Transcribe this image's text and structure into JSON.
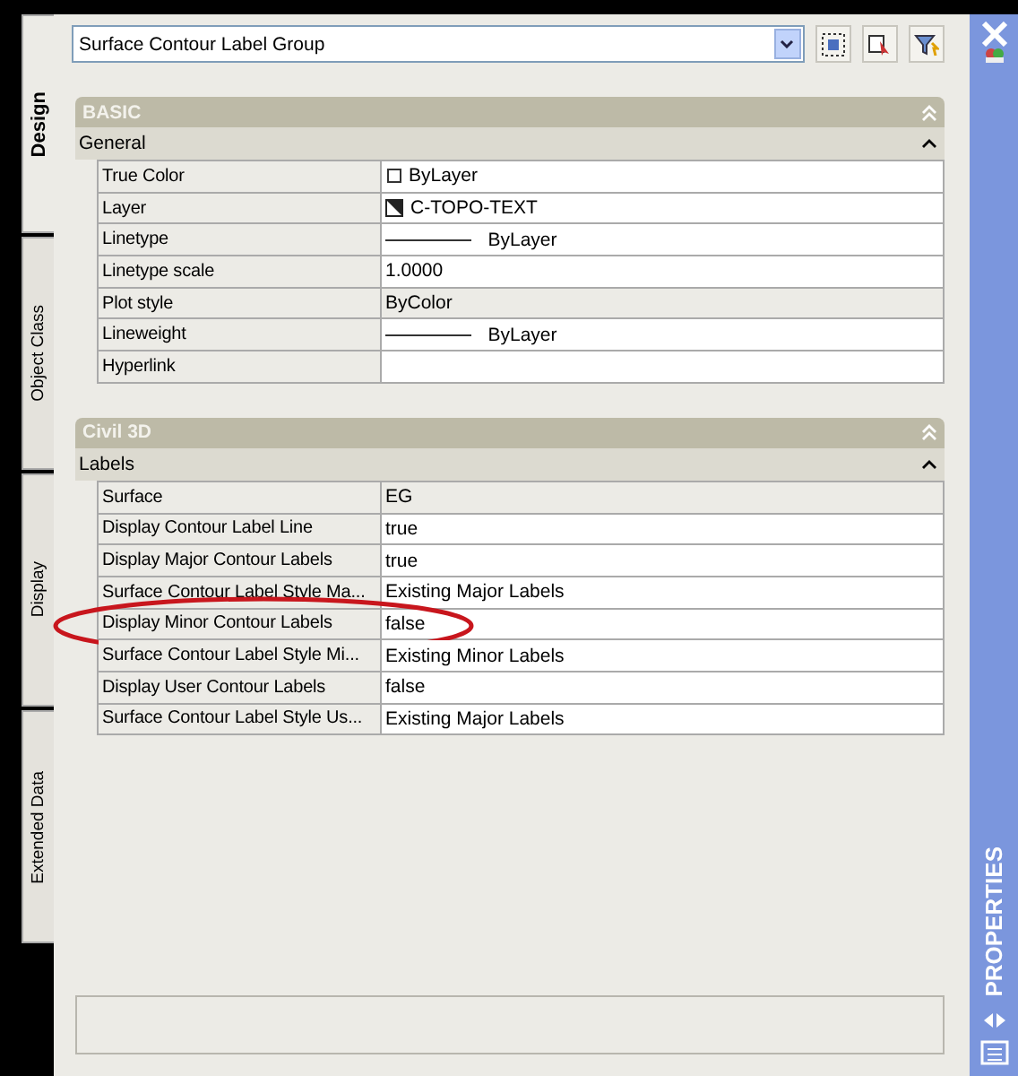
{
  "tabs": [
    {
      "label": "Design",
      "selected": true
    },
    {
      "label": "Object Class",
      "selected": false
    },
    {
      "label": "Display",
      "selected": false
    },
    {
      "label": "Extended Data",
      "selected": false
    }
  ],
  "selector": {
    "value": "Surface Contour Label Group"
  },
  "sections": [
    {
      "title": "BASIC",
      "groups": [
        {
          "title": "General",
          "expanded": true,
          "rows": [
            {
              "name": "True Color",
              "value": "ByLayer",
              "kind": "swatch",
              "readonly": false,
              "circled": false
            },
            {
              "name": "Layer",
              "value": "C-TOPO-TEXT",
              "kind": "layer",
              "readonly": false,
              "circled": false
            },
            {
              "name": "Linetype",
              "value": "ByLayer",
              "kind": "line",
              "readonly": false,
              "circled": false
            },
            {
              "name": "Linetype scale",
              "value": "1.0000",
              "kind": "text",
              "readonly": false,
              "circled": false
            },
            {
              "name": "Plot style",
              "value": "ByColor",
              "kind": "text",
              "readonly": true,
              "circled": false
            },
            {
              "name": "Lineweight",
              "value": "ByLayer",
              "kind": "line",
              "readonly": false,
              "circled": false
            },
            {
              "name": "Hyperlink",
              "kind": "text",
              "readonly": false,
              "circled": false
            }
          ]
        }
      ]
    },
    {
      "title": "Civil 3D",
      "groups": [
        {
          "title": "Labels",
          "expanded": true,
          "rows": [
            {
              "name": "Surface",
              "value": "EG",
              "kind": "text",
              "readonly": true,
              "circled": false
            },
            {
              "name": "Display Contour Label Line",
              "value": "true",
              "kind": "text",
              "readonly": false,
              "circled": false
            },
            {
              "name": "Display Major Contour Labels",
              "value": "true",
              "kind": "text",
              "readonly": false,
              "circled": false
            },
            {
              "name": "Surface Contour Label Style Ma...",
              "value": "Existing Major Labels",
              "kind": "text",
              "readonly": false,
              "circled": false
            },
            {
              "name": "Display Minor Contour Labels",
              "value": "false",
              "kind": "text",
              "readonly": false,
              "circled": true
            },
            {
              "name": "Surface Contour Label Style Mi...",
              "value": "Existing Minor Labels",
              "kind": "text",
              "readonly": false,
              "circled": false
            },
            {
              "name": "Display User Contour Labels",
              "value": "false",
              "kind": "text",
              "readonly": false,
              "circled": false
            },
            {
              "name": "Surface Contour Label Style Us...",
              "value": "Existing Major Labels",
              "kind": "text",
              "readonly": false,
              "circled": false
            }
          ]
        }
      ]
    }
  ],
  "palette_title": "PROPERTIES"
}
